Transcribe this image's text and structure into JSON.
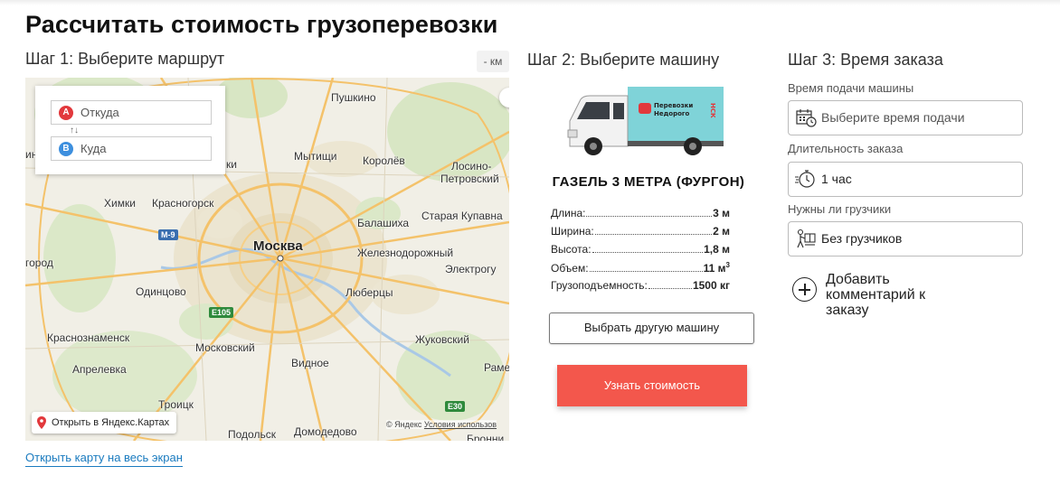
{
  "title": "Рассчитать стоимость грузоперевозки",
  "step1": {
    "title": "Шаг 1: Выберите маршрут",
    "km_badge": "- км",
    "route": {
      "from_placeholder": "Откуда",
      "to_placeholder": "Куда",
      "from_marker": "A",
      "to_marker": "B"
    },
    "map_labels": {
      "pushkino": "Пушкино",
      "mytishchi": "Мытищи",
      "korolev": "Королёв",
      "losino": "Лосино-",
      "losino2": "Петровский",
      "krasnogorsk": "Красногорск",
      "khimki": "Химки",
      "balashikha": "Балашиха",
      "kupavna": "Старая Купавна",
      "moskva": "Москва",
      "zheleznodorozhny": "Железнодорожный",
      "elektrogorsk": "Электрогу",
      "odintsovo": "Одинцово",
      "lyubertsy": "Люберцы",
      "krasnoznamensk": "Краснознаменск",
      "moskovsky": "Московский",
      "zhukovsky": "Жуковский",
      "aprelevka": "Апрелевка",
      "vidnoe": "Видное",
      "ramenskoe": "Раме",
      "troitsk": "Троицк",
      "podolsk": "Подольск",
      "domodedovo": "Домодедово",
      "bronnitsy": "Бронни",
      "gorod": "город",
      "ki": "ки",
      "lino": "ино",
      "m9": "M-9",
      "e105": "E105",
      "e30": "E30"
    },
    "open_yandex": "Открыть в Яндекс.Картах",
    "copyright_brand": "© Яндекс",
    "copyright_terms": "Условия использов",
    "fullscreen_link": "Открыть карту на весь экран"
  },
  "step2": {
    "title": "Шаг 2: Выберите машину",
    "truck_brand_line1": "Перевозки",
    "truck_brand_line2": "Недорого",
    "truck_brand_side": "НСК",
    "truck_name": "ГАЗЕЛЬ 3 МЕТРА (ФУРГОН)",
    "specs": [
      {
        "label": "Длина:",
        "value": "3 м"
      },
      {
        "label": "Ширина:",
        "value": "2 м"
      },
      {
        "label": "Высота:",
        "value": "1,8 м"
      },
      {
        "label": "Объем:",
        "value": "11 м",
        "sup": "3"
      },
      {
        "label": "Грузоподъемность:",
        "value": "1500 кг"
      }
    ],
    "other_button": "Выбрать другую машину",
    "price_button": "Узнать стоимость"
  },
  "step3": {
    "title": "Шаг 3: Время заказа",
    "time_label": "Время подачи машины",
    "time_placeholder": "Выберите время подачи",
    "duration_label": "Длительность заказа",
    "duration_value": "1 час",
    "loaders_label": "Нужны ли грузчики",
    "loaders_value": "Без грузчиков",
    "add_comment": "Добавить комментарий к заказу"
  },
  "colors": {
    "accent_button": "#f3574c",
    "link": "#1a7bbf",
    "marker_a": "#e2383c",
    "marker_b": "#3d8fde",
    "truck_box": "#7fd3d8"
  }
}
